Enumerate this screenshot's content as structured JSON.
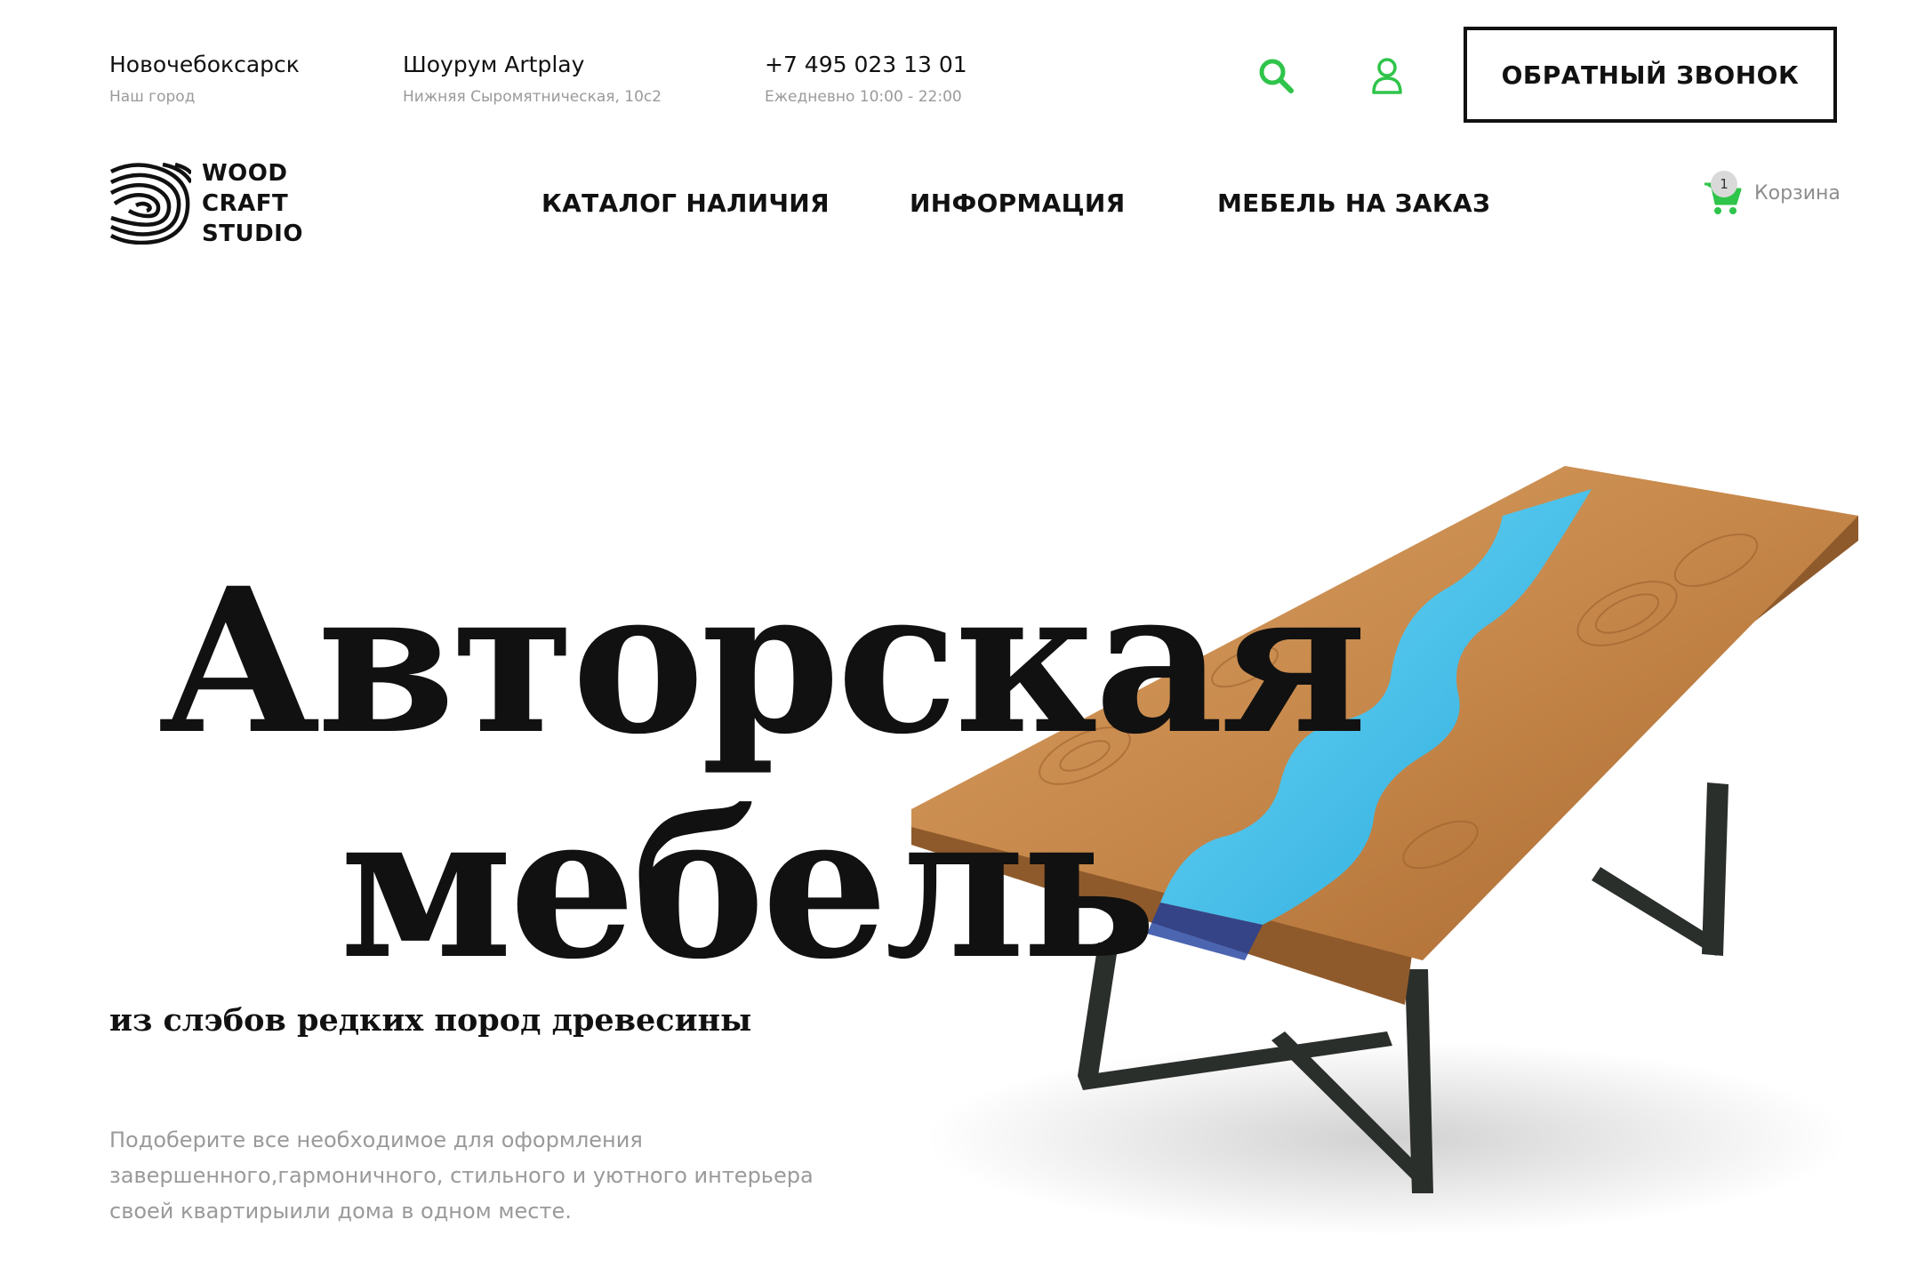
{
  "header": {
    "city": {
      "title": "Новочебоксарск",
      "subtitle": "Наш город"
    },
    "showroom": {
      "title": "Шоурум Artplay",
      "subtitle": "Нижняя Сыромятническая, 10с2"
    },
    "phone": {
      "title": "+7 495 023 13 01",
      "subtitle": "Ежедневно 10:00 - 22:00"
    },
    "icons": {
      "search": "search-icon",
      "account": "user-icon",
      "cart": "cart-icon"
    },
    "callback_label": "ОБРАТНЫЙ ЗВОНОК",
    "accent_color": "#2fc44a"
  },
  "logo": {
    "line1": "WOOD",
    "line2": "CRAFT",
    "line3": "STUDIO"
  },
  "nav": {
    "items": [
      {
        "label": "КАТАЛОГ НАЛИЧИЯ"
      },
      {
        "label": "ИНФОРМАЦИЯ"
      },
      {
        "label": "МЕБЕЛЬ НА ЗАКАЗ"
      }
    ]
  },
  "cart": {
    "count": "1",
    "label": "Корзина"
  },
  "hero": {
    "title_line1": "Авторская",
    "title_line2": "мебель",
    "subtitle": "из слэбов редких пород древесины",
    "description": "Подоберите все необходимое для оформления завершенного,гармоничного, стильного и уютного интерьера своей квартирыили дома в одном месте.",
    "resin_color": "#3dbfe6",
    "wood_color": "#c98a4a"
  }
}
